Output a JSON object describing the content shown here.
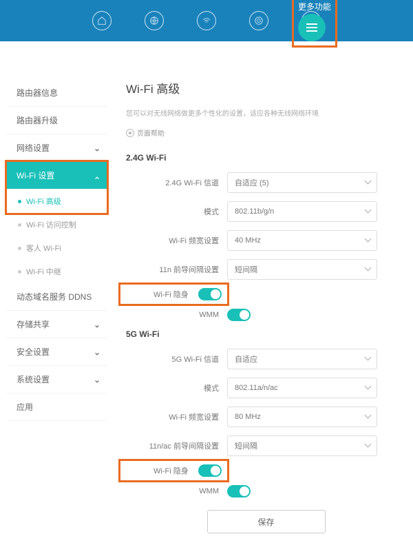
{
  "nav": {
    "more_label": "更多功能"
  },
  "sidebar": {
    "items": [
      {
        "label": "路由器信息"
      },
      {
        "label": "路由器升级"
      },
      {
        "label": "网络设置"
      },
      {
        "label": "Wi-Fi 设置",
        "expanded": true,
        "children": [
          {
            "label": "Wi-Fi 高级",
            "active": true
          },
          {
            "label": "Wi-Fi 访问控制"
          },
          {
            "label": "客人 Wi-Fi"
          },
          {
            "label": "Wi-Fi 中继"
          }
        ]
      },
      {
        "label": "动态域名服务 DDNS"
      },
      {
        "label": "存储共享"
      },
      {
        "label": "安全设置"
      },
      {
        "label": "系统设置"
      },
      {
        "label": "应用"
      }
    ]
  },
  "content": {
    "title": "Wi-Fi 高级",
    "desc": "您可以对无线网络做更多个性化的设置，适应各种无线网络环境",
    "help": "页面帮助",
    "g24": {
      "title": "2.4G Wi-Fi",
      "channel_label": "2.4G Wi-Fi 信道",
      "channel_value": "自适应 (5)",
      "mode_label": "模式",
      "mode_value": "802.11b/g/n",
      "bw_label": "Wi-Fi 频宽设置",
      "bw_value": "40 MHz",
      "guard_label": "11n 前导间隔设置",
      "guard_value": "短间隔",
      "hide_label": "Wi-Fi 隐身",
      "wmm_label": "WMM"
    },
    "g5": {
      "title": "5G Wi-Fi",
      "channel_label": "5G Wi-Fi 信道",
      "channel_value": "自适应",
      "mode_label": "模式",
      "mode_value": "802.11a/n/ac",
      "bw_label": "Wi-Fi 频宽设置",
      "bw_value": "80 MHz",
      "guard_label": "11n/ac 前导间隔设置",
      "guard_value": "短间隔",
      "hide_label": "Wi-Fi 隐身",
      "wmm_label": "WMM"
    },
    "save": "保存"
  }
}
